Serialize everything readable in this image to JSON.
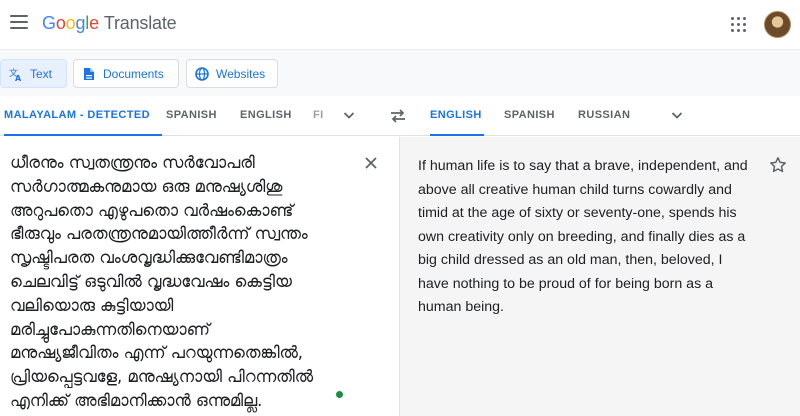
{
  "app": {
    "logo_letters": [
      "G",
      "o",
      "o",
      "g",
      "l",
      "e"
    ],
    "logo_suffix": "Translate",
    "brand_colors": [
      "#4285f4",
      "#ea4335",
      "#fbbc05",
      "#4285f4",
      "#34a853",
      "#ea4335"
    ],
    "accent_color": "#1a73e8",
    "menu_icon": "hamburger-menu-icon",
    "apps_icon": "apps-grid-icon",
    "avatar_icon": "user-avatar"
  },
  "modes": [
    {
      "label": "Text",
      "icon": "translate-icon",
      "active": true
    },
    {
      "label": "Documents",
      "icon": "document-icon",
      "active": false
    },
    {
      "label": "Websites",
      "icon": "globe-icon",
      "active": false
    }
  ],
  "source_languages": [
    {
      "label": "MALAYALAM - DETECTED",
      "active": true
    },
    {
      "label": "SPANISH",
      "active": false
    },
    {
      "label": "ENGLISH",
      "active": false
    },
    {
      "label": "FI",
      "active": false
    }
  ],
  "target_languages": [
    {
      "label": "ENGLISH",
      "active": true
    },
    {
      "label": "SPANISH",
      "active": false
    },
    {
      "label": "RUSSIAN",
      "active": false
    }
  ],
  "source": {
    "lines": [
      "ധീരനും സ്വതന്ത്രനും സർവോപരി",
      "സർഗാത്മകനുമായ ഒരു മനുഷ്യശിശു",
      "അറുപതൊ എഴുപതൊ വർഷംകൊണ്ട്",
      "ഭീരുവും പരതന്ത്രനുമായിത്തീർന്ന് സ്വന്തം",
      "സൃഷ്ടിപരത വംശവൃദ്ധിക്കുവേണ്ടിമാത്രം",
      "ചെലവിട്ട് ഒടുവിൽ വൃദ്ധവേഷം കെട്ടിയ",
      "വലിയൊരു കുട്ടിയായി",
      "മരിച്ചുപോകുന്നതിനെയാണ്",
      "മനുഷ്യജീവിതം എന്ന് പറയുന്നതെങ്കിൽ,",
      "പ്രിയപ്പെട്ടവളേ, മനുഷ്യനായി പിറന്നതിൽ",
      "എനിക്ക് അഭിമാനിക്കാൻ ഒന്നുമില്ല."
    ],
    "clear_icon": "close-icon"
  },
  "translation": {
    "lines": [
      "If human life is to say that a brave, independent, and",
      "above all creative human child turns cowardly and",
      "timid at the age of sixty or seventy-one, spends his",
      "own creativity only on breeding, and finally dies as a",
      "big child dressed as an old man, then, beloved, I",
      "have nothing to be proud of for being born as a",
      "human being."
    ],
    "star_icon": "star-outline-icon"
  }
}
